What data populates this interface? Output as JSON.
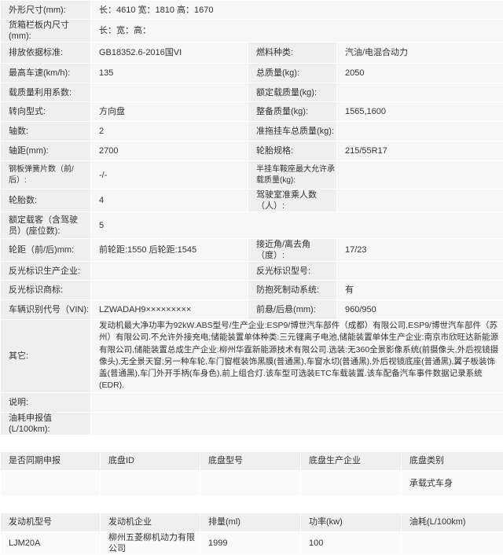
{
  "spec": {
    "outer_dimensions": {
      "label": "外形尺寸(mm):",
      "value": "长：4610 宽：1810 高：1670"
    },
    "cargo_dimensions": {
      "label": "货箱栏板内尺寸(mm):",
      "value": "长：宽：高："
    },
    "emission_standard": {
      "label": "排放依据标准:",
      "value": "GB18352.6-2016国VI"
    },
    "fuel_type": {
      "label": "燃料种类:",
      "value": "汽油/电混合动力"
    },
    "max_speed": {
      "label": "最高车速(km/h):",
      "value": "135"
    },
    "total_mass": {
      "label": "总质量(kg):",
      "value": "2050"
    },
    "load_mass_coef": {
      "label": "载质量利用系数:",
      "value": ""
    },
    "rated_load": {
      "label": "额定载质量(kg):",
      "value": ""
    },
    "steering": {
      "label": "转向型式:",
      "value": "方向盘"
    },
    "curb_weight": {
      "label": "整备质量(kg):",
      "value": "1565,1600"
    },
    "axles": {
      "label": "轴数:",
      "value": "2"
    },
    "trailer_mass": {
      "label": "准拖挂车总质量(kg):",
      "value": ""
    },
    "wheelbase": {
      "label": "轴距(mm):",
      "value": "2700"
    },
    "tire": {
      "label": "轮胎规格:",
      "value": "215/55R17"
    },
    "leaf_springs": {
      "label": "钢板弹簧片数（前/后）:",
      "value": "-/-"
    },
    "semi_trailer": {
      "label": "半挂车鞍座最大允许承载质量(kg):",
      "value": ""
    },
    "tire_count": {
      "label": "轮胎数:",
      "value": "4"
    },
    "cab_passengers": {
      "label": "驾驶室准乘人数（人）:",
      "value": ""
    },
    "seating": {
      "label": "额定载客（含驾驶员）(座位数):",
      "value": "5"
    },
    "track": {
      "label": "轮距（前/后)mm:",
      "value": "前轮距:1550 后轮距:1545"
    },
    "angles": {
      "label": "接近角/离去角（度）:",
      "value": "17/23"
    },
    "reflector_maker": {
      "label": "反光标识生产企业:",
      "value": ""
    },
    "reflector_model": {
      "label": "反光标识型号:",
      "value": ""
    },
    "reflector_brand": {
      "label": "反光标识商标:",
      "value": ""
    },
    "abs": {
      "label": "防抱死制动系统:",
      "value": "有"
    },
    "vin": {
      "label": "车辆识别代号（VIN):",
      "value": "LZWADAH9×××××××××"
    },
    "overhang": {
      "label": "前悬/后悬(mm):",
      "value": "960/950"
    },
    "other": {
      "label": "其它:",
      "value": "发动机最大净功率为92kW.ABS型号/生产企业:ESP9/博世汽车部件（成都）有限公司,ESP9/博世汽车部件（苏州）有限公司.不允许外接充电;储能装置单体种类:三元锂离子电池,储能装置单体生产企业:南京市欣旺达新能源有限公司,储能装置总成生产企业:柳州华霆新能源技术有限公司.选装:无360全景影像系统(前摄像头,外后视镜摄像头),无全景天窗;另一种车轮,车门窗框装饰黑膜(普通黑),车窗水切(普通黑),外后视镜底座(普通黑),翼子板装饰盖(普通黑),车门外开手柄(车身色),前上组合灯.该车型可选装ETC车载装置.该车配备汽车事件数据记录系统(EDR)."
    },
    "notes": {
      "label": "说明:",
      "value": ""
    },
    "fuel_consumption": {
      "label": "油耗申报值(L/100km):",
      "value": ""
    }
  },
  "chassis": {
    "headers": [
      "是否同期申报",
      "底盘ID",
      "底盘型号",
      "底盘生产企业",
      "底盘类别"
    ],
    "row": [
      "",
      "",
      "",
      "",
      "承载式车身"
    ]
  },
  "engine": {
    "headers": [
      "发动机型号",
      "发动机企业",
      "排量(ml)",
      "功率(kw)",
      "油耗(L/100km)"
    ],
    "row": [
      "LJM20A",
      "柳州五菱柳机动力有限公司",
      "1999",
      "100",
      ""
    ]
  }
}
